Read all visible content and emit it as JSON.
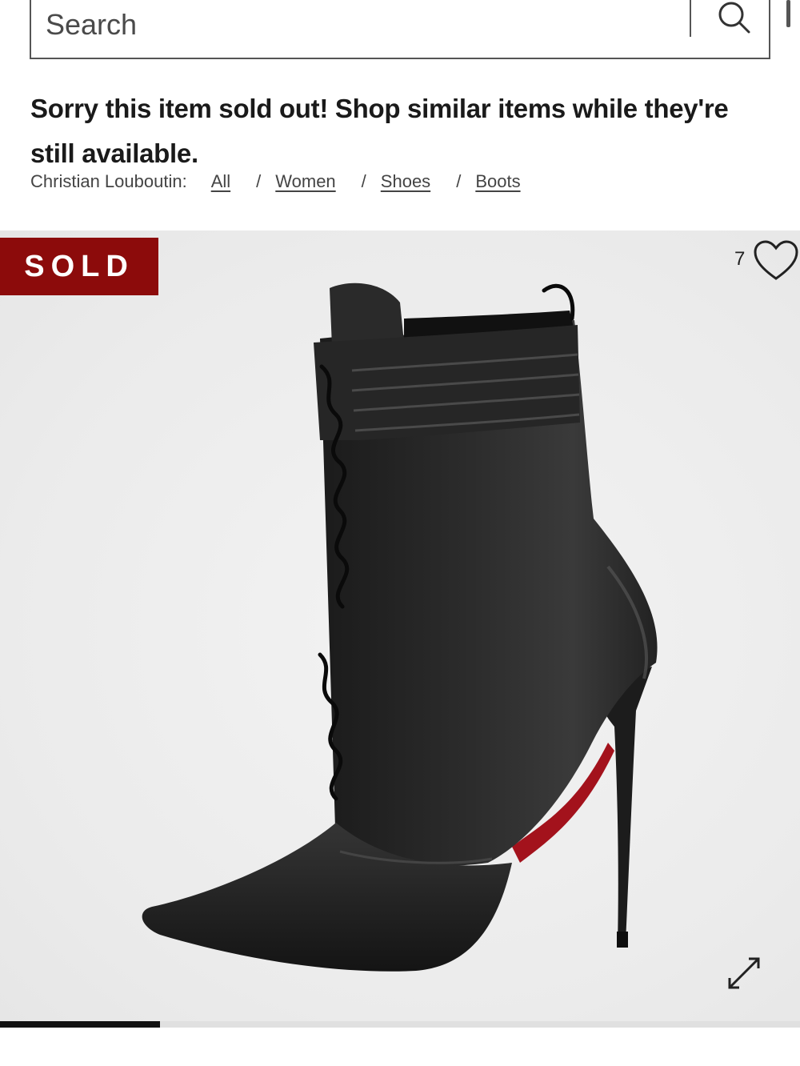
{
  "search": {
    "placeholder": "Search",
    "icon": "search-icon"
  },
  "notice": {
    "message": "Sorry this item sold out! Shop similar items while they're still available."
  },
  "breadcrumb": {
    "brand": "Christian Louboutin:",
    "items": [
      {
        "label": "All"
      },
      {
        "label": "Women"
      },
      {
        "label": "Shoes"
      },
      {
        "label": "Boots"
      }
    ],
    "separator": "/"
  },
  "product": {
    "status_badge": "SOLD",
    "favorites_count": "7",
    "heart_icon": "heart-icon",
    "expand_icon": "expand-arrows-icon",
    "image_subject": "black leather lace-up stiletto ankle boot",
    "carousel": {
      "current_fraction": 0.2
    }
  },
  "colors": {
    "sold_badge": "#8c0b0b",
    "sole_accent": "#c8102e",
    "image_background": "#ececec"
  }
}
